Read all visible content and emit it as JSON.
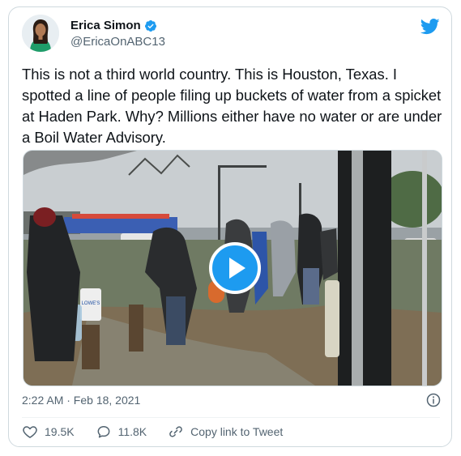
{
  "author": {
    "name": "Erica Simon",
    "handle": "@EricaOnABC13"
  },
  "tweet": {
    "text": "This is not a third world country. This is Houston, Texas. I spotted a line of people filing up buckets of water from a spicket at Haden Park. Why? Millions either have no water or are under a Boil Water Advisory.",
    "timestamp": "2:22 AM · Feb 18, 2021"
  },
  "actions": {
    "likes": "19.5K",
    "replies": "11.8K",
    "copy_link": "Copy link to Tweet"
  },
  "media": {
    "bucket_label": "LOWE'S"
  },
  "colors": {
    "accent": "#1d9bf0",
    "text": "#0f1419",
    "muted": "#536471",
    "border": "#cfd9de"
  },
  "icons": [
    "verified-badge-icon",
    "twitter-bird-icon",
    "play-icon",
    "info-icon",
    "heart-icon",
    "reply-icon",
    "link-icon"
  ]
}
